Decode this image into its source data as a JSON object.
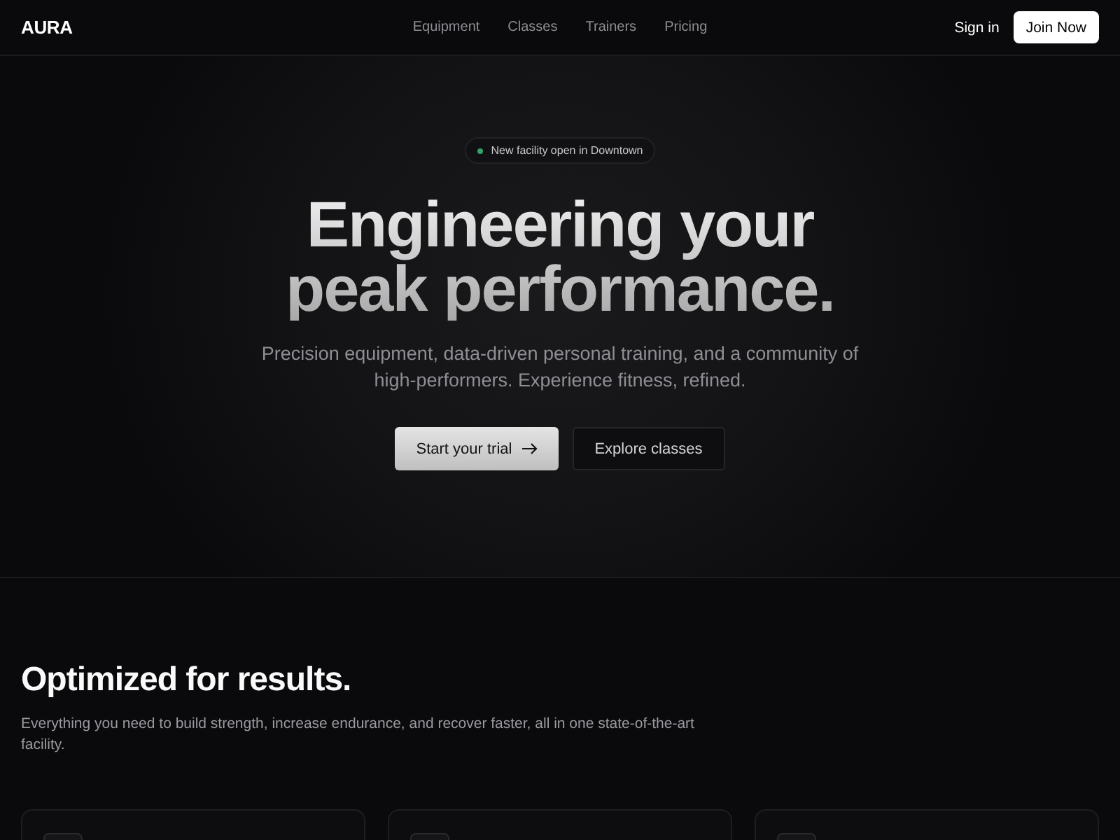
{
  "nav": {
    "brand": "AURA",
    "links": [
      "Equipment",
      "Classes",
      "Trainers",
      "Pricing"
    ],
    "sign_in": "Sign in",
    "cta": "Join Now"
  },
  "hero": {
    "badge": "New facility open in Downtown",
    "title": "Engineering your peak performance.",
    "subtitle": "Precision equipment, data-driven personal training, and a community of high-performers. Experience fitness, refined.",
    "primary": "Start your trial",
    "secondary": "Explore classes"
  },
  "features": {
    "heading": "Optimized for results.",
    "text": "Everything you need to build strength, increase endurance, and recover faster, all in one state-of-the-art facility.",
    "cards": [
      {
        "kind": "feature"
      },
      {
        "kind": "feature"
      },
      {
        "kind": "feature"
      }
    ]
  }
}
